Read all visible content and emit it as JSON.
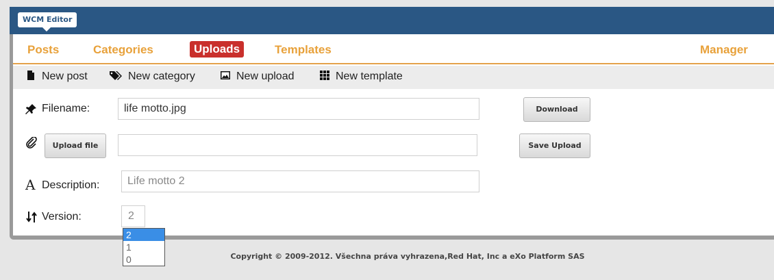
{
  "app": {
    "badge": "WCM Editor"
  },
  "nav": {
    "items": [
      "Posts",
      "Categories",
      "Uploads",
      "Templates"
    ],
    "active": "Uploads",
    "manager": "Manager"
  },
  "toolbar": {
    "new_post": "New post",
    "new_category": "New category",
    "new_upload": "New upload",
    "new_template": "New template"
  },
  "form": {
    "filename_label": "Filename:",
    "filename_value": "life motto.jpg",
    "download_label": "Download",
    "upload_file_label": "Upload file",
    "upload_path_value": "",
    "save_upload_label": "Save Upload",
    "description_label": "Description:",
    "description_value": "Life motto 2",
    "version_label": "Version:",
    "version_value": "2",
    "version_options": [
      "2",
      "1",
      "0"
    ]
  },
  "footer": {
    "copyright": "Copyright © 2009-2012. Všechna práva vyhrazena,Red Hat, Inc a eXo Platform SAS"
  },
  "colors": {
    "header_blue": "#2a5784",
    "nav_orange": "#e8a13a",
    "active_red": "#c9302c",
    "select_blue": "#3a8ee6"
  }
}
